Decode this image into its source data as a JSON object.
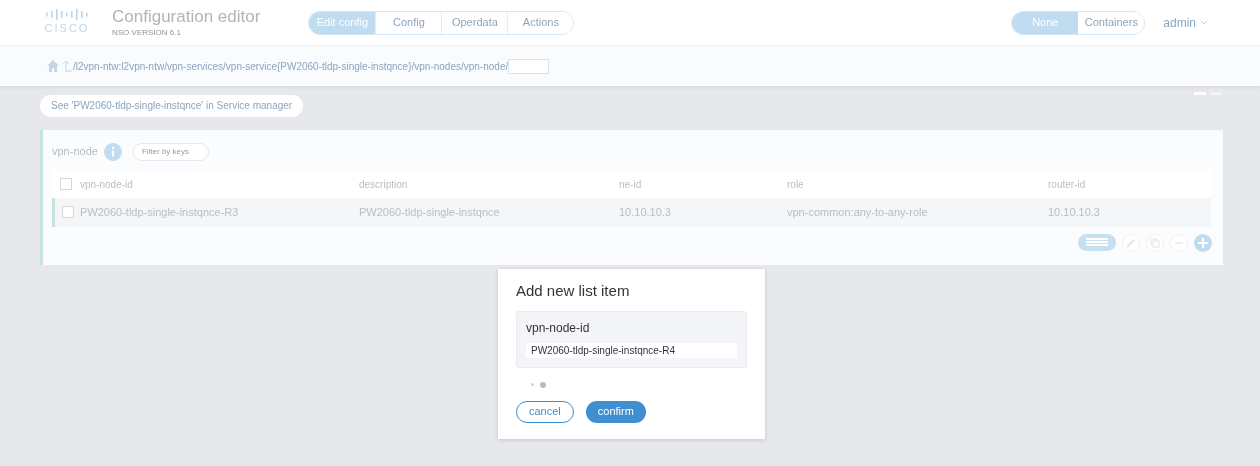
{
  "header": {
    "logo_text": "CISCO",
    "title": "Configuration editor",
    "version": "NSO VERSION 6.1",
    "tabs": [
      {
        "label": "Edit config",
        "selected": true
      },
      {
        "label": "Config",
        "selected": false
      },
      {
        "label": "Operdata",
        "selected": false
      },
      {
        "label": "Actions",
        "selected": false
      }
    ],
    "view_modes": [
      {
        "label": "None",
        "selected": true
      },
      {
        "label": "Containers",
        "selected": false
      }
    ],
    "user": "admin"
  },
  "breadcrumb": {
    "path": "/l2vpn-ntw:l2vpn-ntw/vpn-services/vpn-service{PW2060-tldp-single-instqnce}/vpn-nodes/vpn-node/"
  },
  "service_link": "See 'PW2060-tldp-single-instqnce' in Service manager",
  "list": {
    "title": "vpn-node",
    "filter_placeholder": "Filter by keys",
    "select_all_checked": false,
    "columns": [
      "vpn-node-id",
      "description",
      "ne-id",
      "role",
      "router-id"
    ],
    "rows": [
      {
        "checked": false,
        "cells": [
          "PW2060-tldp-single-instqnce-R3",
          "PW2060-tldp-single-instqnce",
          "10.10.10.3",
          "vpn-common:any-to-any-role",
          "10.10.10.3"
        ]
      }
    ]
  },
  "dialog": {
    "title": "Add new list item",
    "field_label": "vpn-node-id",
    "field_value": "PW2060-tldp-single-instqnce-R4",
    "buttons": [
      "cancel",
      "confirm"
    ]
  }
}
